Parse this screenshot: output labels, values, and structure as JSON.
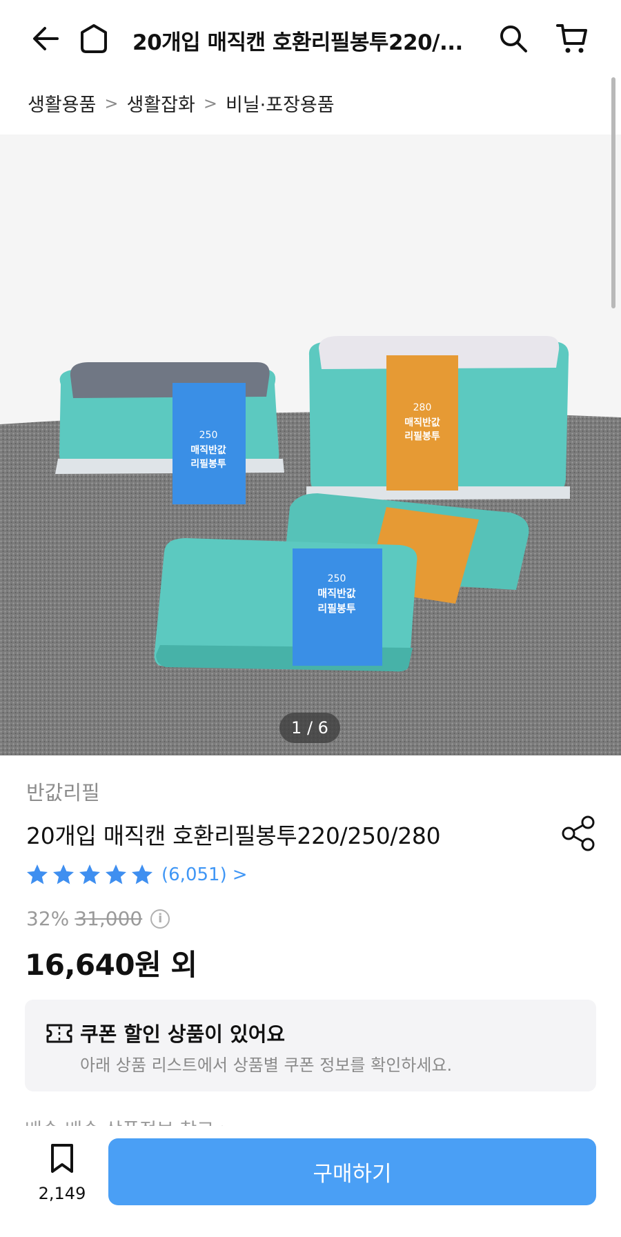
{
  "header": {
    "title": "20개입 매직캔 호환리필봉투220/...",
    "back_icon": "back-arrow-icon",
    "home_icon": "home-icon",
    "search_icon": "search-icon",
    "cart_icon": "cart-icon"
  },
  "breadcrumb": [
    "생활용품",
    "생활잡화",
    "비닐·포장용품"
  ],
  "image": {
    "counter": "1 / 6",
    "label_blue_size": "250",
    "label_orange_size": "280",
    "label_text_line1": "매직반값",
    "label_text_line2": "리필봉투"
  },
  "product": {
    "brand": "반값리필",
    "name": "20개입 매직캔 호환리필봉투220/250/280",
    "rating_stars": 5,
    "review_count": "(6,051)",
    "discount": "32%",
    "original_price": "31,000",
    "sale_price": "16,640원 외"
  },
  "coupon": {
    "title": "쿠폰 할인 상품이 있어요",
    "subtitle": "아래 상품 리스트에서 상품별 쿠폰 정보를 확인하세요."
  },
  "cut_row": "배송    배송 상품정보 참고 >",
  "bottom": {
    "bookmark_count": "2,149",
    "buy_label": "구매하기"
  },
  "colors": {
    "accent": "#4a9ff5",
    "star": "#3f8ff0",
    "teal": "#5cc9c0",
    "label_blue": "#3a8fe6",
    "label_orange": "#e69a34"
  }
}
